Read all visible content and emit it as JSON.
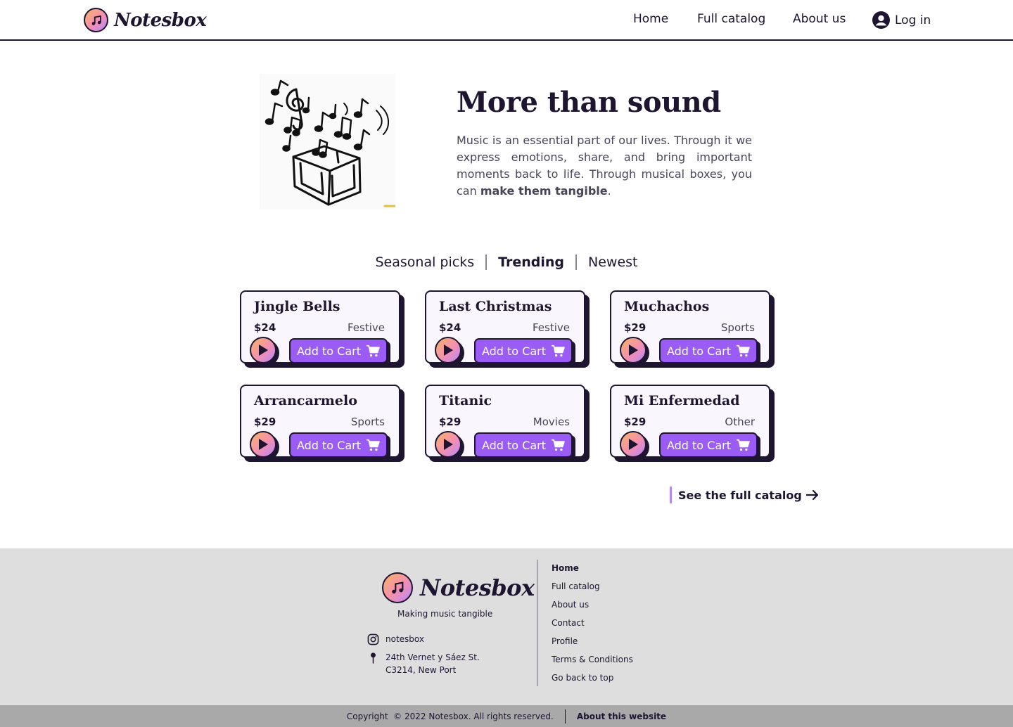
{
  "brand": {
    "name": "Notesbox",
    "tagline": "Making music tangible"
  },
  "nav": {
    "home": "Home",
    "catalog": "Full catalog",
    "about": "About us",
    "login": "Log in"
  },
  "hero": {
    "title": "More than sound",
    "text_before": "Music is an essential part of our lives. Through it we express emotions, share, and bring important moments back to life. Through musical boxes, you can ",
    "text_bold": "make them tangible",
    "text_after": "."
  },
  "tabs": [
    {
      "label": "Seasonal picks",
      "active": false
    },
    {
      "label": "Trending",
      "active": true
    },
    {
      "label": "Newest",
      "active": false
    }
  ],
  "add_to_cart_label": "Add to Cart",
  "products": [
    {
      "title": "Jingle Bells",
      "price": "$24",
      "category": "Festive"
    },
    {
      "title": "Last Christmas",
      "price": "$24",
      "category": "Festive"
    },
    {
      "title": "Muchachos",
      "price": "$29",
      "category": "Sports"
    },
    {
      "title": "Arrancarmelo",
      "price": "$29",
      "category": "Sports"
    },
    {
      "title": "Titanic",
      "price": "$29",
      "category": "Movies"
    },
    {
      "title": "Mi Enfermedad",
      "price": "$29",
      "category": "Other"
    }
  ],
  "see_full_catalog": "See the full catalog",
  "footer": {
    "instagram": "notesbox",
    "address_line1": "24th Vernet y Sáez St.",
    "address_line2": "C3214, New Port",
    "links": [
      "Home",
      "Full catalog",
      "About us",
      "Contact",
      "Profile",
      "Terms & Conditions",
      "Go back to top"
    ],
    "copyright": "Copyright  © 2022 Notesbox. All rights reserved.",
    "about_site": "About this website"
  },
  "colors": {
    "ink": "#1e1530",
    "accent": "#9b5cf6",
    "lavender": "#b388ff",
    "footer_bg": "#dedede",
    "bottom_bar": "#a9a9a9"
  }
}
